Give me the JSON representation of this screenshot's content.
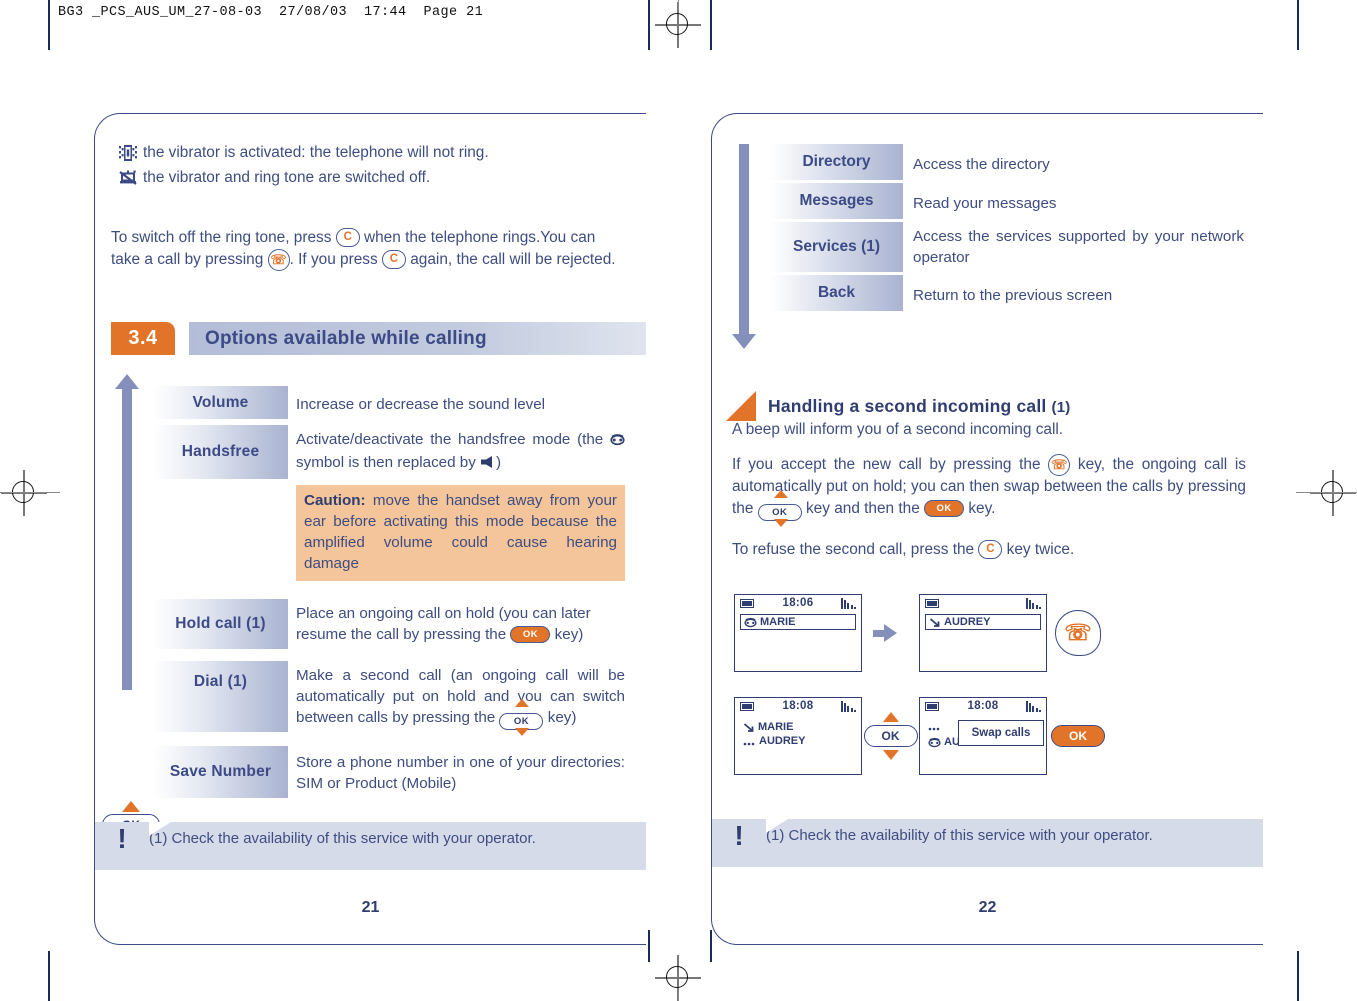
{
  "document": {
    "header_line": "BG3 _PCS_AUS_UM_27-08-03  27/08/03  17:44  Page 21"
  },
  "colors": {
    "orange": "#e2742a",
    "dark_blue": "#2f3d70",
    "body_blue": "#3e4d80",
    "bar_blue": "#a9b3d1",
    "caution_bg": "#f4c49a",
    "footnote_bg": "#d6dbe9"
  },
  "left_page": {
    "page_number": "21",
    "vibrator_notes": [
      {
        "icon": "vibrator-on-icon",
        "text": "the vibrator is activated: the telephone will not ring."
      },
      {
        "icon": "vibrator-ring-off-icon",
        "text": "the vibrator and ring tone are switched off."
      }
    ],
    "intro_paragraph": {
      "part1": "To switch off the ring tone, press",
      "key1": "c",
      "part2": "when the telephone rings.You can take a call by pressing",
      "key2": "phone",
      "part3": ". If you press",
      "key3": "c",
      "part4": "again, the call will be rejected."
    },
    "section": {
      "number": "3.4",
      "title": "Options available while calling"
    },
    "options": [
      {
        "label": "Volume",
        "desc": "Increase or decrease the sound level"
      },
      {
        "label": "Handsfree",
        "desc_part1": "Activate/deactivate the handsfree mode (the",
        "desc_icon1": "handset-icon",
        "desc_part2": "symbol is then replaced by",
        "desc_icon2": "speaker-icon",
        "desc_part3": ")",
        "caution_label": "Caution:",
        "caution_text": "move the handset away from your ear before activating this mode because the amplified volume could cause hearing damage"
      },
      {
        "label": "Hold call (1)",
        "desc_part1": "Place an ongoing call on hold (you can later resume the call by pressing the",
        "desc_key": "OK",
        "desc_part2": "key)"
      },
      {
        "label": "Dial (1)",
        "desc_part1": "Make a second call (an ongoing call will be automatically put on hold and you can switch between calls by pressing the",
        "desc_key": "OK",
        "desc_part2": "key)"
      },
      {
        "label": "Save Number",
        "desc": "Store a phone number in one of your directories: SIM or Product (Mobile)"
      }
    ],
    "nav_key_label": "OK",
    "footnote": {
      "marker": "!",
      "text": "(1) Check the availability of this service with your operator."
    }
  },
  "right_page": {
    "page_number": "22",
    "menu": [
      {
        "label": "Directory",
        "desc": "Access the directory"
      },
      {
        "label": "Messages",
        "desc": "Read your messages"
      },
      {
        "label": "Services (1)",
        "desc": "Access the services supported by your network operator"
      },
      {
        "label": "Back",
        "desc": "Return to the previous screen"
      }
    ],
    "subsection": {
      "title": "Handling a second incoming call",
      "superscript": "(1)"
    },
    "paragraphs": {
      "p1": "A beep will inform you of a second incoming call.",
      "p2_part1": "If you accept the new call by pressing the",
      "p2_key1": "phone",
      "p2_part2": "key, the ongoing call is automatically put on hold; you can then swap between the calls by pressing the",
      "p2_key2": "OK",
      "p2_part3": "key and then the",
      "p2_key3": "OK",
      "p2_part4": "key.",
      "p3_part1": "To refuse the second call, press the",
      "p3_key": "c",
      "p3_part2": "key twice."
    },
    "screens": [
      {
        "id": "screen-1",
        "time": "18:06",
        "rows": [
          {
            "icon": "handset-icon",
            "text": "MARIE",
            "boxed": true
          }
        ]
      },
      {
        "id": "screen-2",
        "time": "",
        "rows": [
          {
            "icon": "incoming-call-icon",
            "text": "AUDREY",
            "boxed": true
          }
        ]
      },
      {
        "id": "screen-3",
        "time": "18:08",
        "rows": [
          {
            "icon": "incoming-call-icon",
            "text": "MARIE",
            "boxed": false
          },
          {
            "icon": "dots-icon",
            "text": "AUDREY",
            "boxed": false
          }
        ]
      },
      {
        "id": "screen-4",
        "time": "18:08",
        "popup": "Swap calls",
        "rows": [
          {
            "icon": "dots-icon",
            "text": "",
            "boxed": false
          },
          {
            "icon": "handset-icon",
            "text": "AUDREY",
            "boxed": false
          }
        ]
      }
    ],
    "screen_keys": {
      "arrow": "arrow-right-icon",
      "phone_key": "phone-key",
      "ok_nav_key": "OK",
      "ok_solid_key": "OK"
    },
    "footnote": {
      "marker": "!",
      "text": "(1) Check the availability of this service with your operator."
    }
  }
}
